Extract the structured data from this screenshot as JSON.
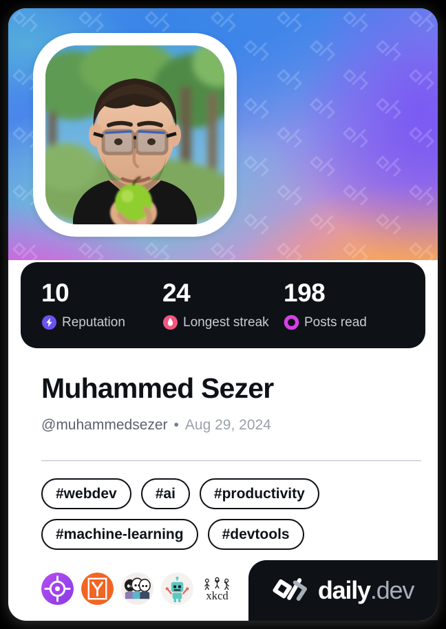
{
  "card": {
    "background_color": "#ffffff",
    "page_background": "#000000"
  },
  "cover": {
    "watermark_icon": "code-slash-pattern-icon",
    "gradient_colors": [
      "#53a8e0",
      "#4b86ec",
      "#8f9ae8",
      "#d08fd0",
      "#f0a46a",
      "#7956f4",
      "#e84edc"
    ]
  },
  "avatar": {
    "alt": "profile-photo",
    "description": "Man with dark hair and black glasses holding a green apple, outdoors with trees"
  },
  "stats": {
    "background_color": "#0e1217",
    "items": [
      {
        "value": "10",
        "label": "Reputation",
        "icon": "reputation-bolt-icon",
        "color": "#6a53f0"
      },
      {
        "value": "24",
        "label": "Longest streak",
        "icon": "streak-flame-icon",
        "color": "#f4557f"
      },
      {
        "value": "198",
        "label": "Posts read",
        "icon": "posts-read-ring-icon",
        "color": "#d640e8"
      }
    ]
  },
  "profile": {
    "name": "Muhammed Sezer",
    "handle": "@muhammedsezer",
    "separator": "•",
    "joined_date": "Aug 29, 2024"
  },
  "tags": [
    {
      "label": "#webdev"
    },
    {
      "label": "#ai"
    },
    {
      "label": "#productivity"
    },
    {
      "label": "#machine-learning"
    },
    {
      "label": "#devtools"
    }
  ],
  "sources": [
    {
      "name": "target-crosshair-source-icon",
      "title": "target"
    },
    {
      "name": "y-combinator-source-icon",
      "title": "Y Combinator"
    },
    {
      "name": "three-figures-source-icon",
      "title": "three figures"
    },
    {
      "name": "robot-source-icon",
      "title": "robot"
    },
    {
      "name": "xkcd-source-icon",
      "title": "xkcd"
    }
  ],
  "logo": {
    "mark": "daily-dev-code-slash-icon",
    "word": "daily",
    "tld": ".dev"
  }
}
